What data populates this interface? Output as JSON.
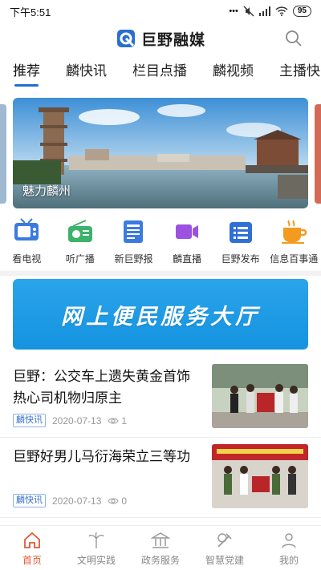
{
  "status_bar": {
    "time": "下午5:51",
    "battery": "95"
  },
  "header": {
    "app_name": "巨野融媒"
  },
  "tabs": [
    {
      "label": "推荐"
    },
    {
      "label": "麟快讯"
    },
    {
      "label": "栏目点播"
    },
    {
      "label": "麟视频"
    },
    {
      "label": "主播快"
    }
  ],
  "banner": {
    "caption": "魅力麟州"
  },
  "quick_links": [
    {
      "label": "看电视",
      "icon": "tv-icon",
      "color": "#3b7be0"
    },
    {
      "label": "听广播",
      "icon": "radio-icon",
      "color": "#3bb36a"
    },
    {
      "label": "新巨野报",
      "icon": "newspaper-icon",
      "color": "#3b7be0"
    },
    {
      "label": "麟直播",
      "icon": "live-camera-icon",
      "color": "#9b52e0"
    },
    {
      "label": "巨野发布",
      "icon": "publish-list-icon",
      "color": "#2f6fd6"
    },
    {
      "label": "信息百事通",
      "icon": "coffee-cup-icon",
      "color": "#f29b1e"
    }
  ],
  "service_banner": {
    "text": "网上便民服务大厅"
  },
  "news": [
    {
      "title": "巨野：公交车上遗失黄金首饰 热心司机物归原主",
      "tag": "麟快讯",
      "date": "2020-07-13",
      "views": "1"
    },
    {
      "title": "巨野好男儿马衍海荣立三等功",
      "tag": "麟快讯",
      "date": "2020-07-13",
      "views": "0"
    }
  ],
  "bottom_nav": [
    {
      "label": "首页",
      "icon": "home-icon",
      "active": true
    },
    {
      "label": "文明实践",
      "icon": "civilization-icon",
      "active": false
    },
    {
      "label": "政务服务",
      "icon": "government-icon",
      "active": false
    },
    {
      "label": "智慧党建",
      "icon": "party-icon",
      "active": false
    },
    {
      "label": "我的",
      "icon": "profile-icon",
      "active": false
    }
  ],
  "colors": {
    "accent": "#1e6fd1",
    "active_nav": "#e05a3a",
    "service_blue": "#1a9be6"
  }
}
